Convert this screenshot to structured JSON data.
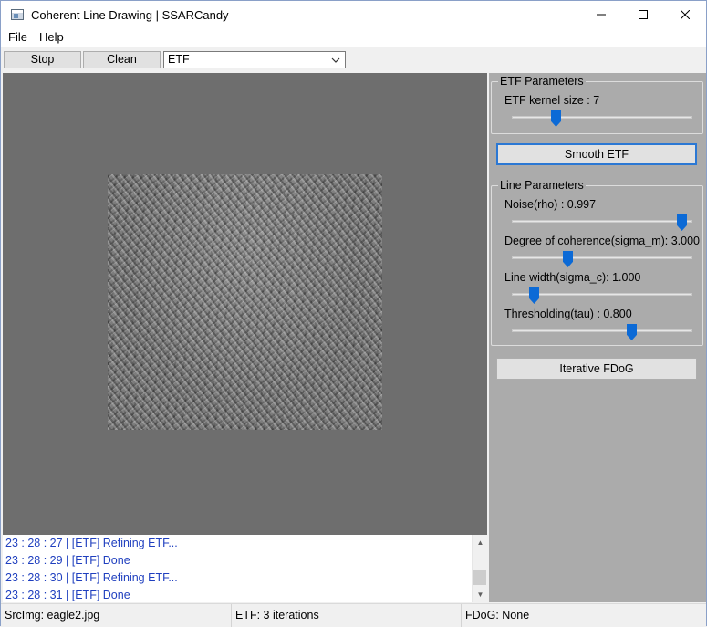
{
  "window": {
    "title": "Coherent Line Drawing | SSARCandy",
    "minimize_icon": "minimize-icon",
    "maximize_icon": "maximize-icon",
    "close_icon": "close-icon"
  },
  "menu": {
    "items": [
      "File",
      "Help"
    ]
  },
  "toolbar": {
    "stop_label": "Stop",
    "clean_label": "Clean",
    "mode_selected": "ETF"
  },
  "etf_group": {
    "title": "ETF Parameters",
    "kernel_label": "ETF kernel size : 7",
    "kernel_slider_fraction": 0.24
  },
  "smooth_button": "Smooth ETF",
  "line_group": {
    "title": "Line Parameters",
    "params": [
      {
        "label": "Noise(rho) : 0.997",
        "fraction": 0.94
      },
      {
        "label": "Degree of coherence(sigma_m): 3.000",
        "fraction": 0.31
      },
      {
        "label": "Line width(sigma_c): 1.000",
        "fraction": 0.12
      },
      {
        "label": "Thresholding(tau) : 0.800",
        "fraction": 0.66
      }
    ]
  },
  "fdog_button": "Iterative FDoG",
  "log": [
    "23 : 28 : 27  |  [ETF] Refining ETF...",
    "23 : 28 : 29  |  [ETF] Done",
    "23 : 28 : 30  |  [ETF] Refining ETF...",
    "23 : 28 : 31  |  [ETF] Done"
  ],
  "status": {
    "src": "SrcImg: eagle2.jpg",
    "etf": "ETF: 3 iterations",
    "fdog": "FDoG: None"
  },
  "colors": {
    "canvas_bg": "#6e6e6e",
    "panel_bg": "#ababab",
    "slider_thumb": "#0c6ad6",
    "log_text": "#1f3fbf"
  }
}
